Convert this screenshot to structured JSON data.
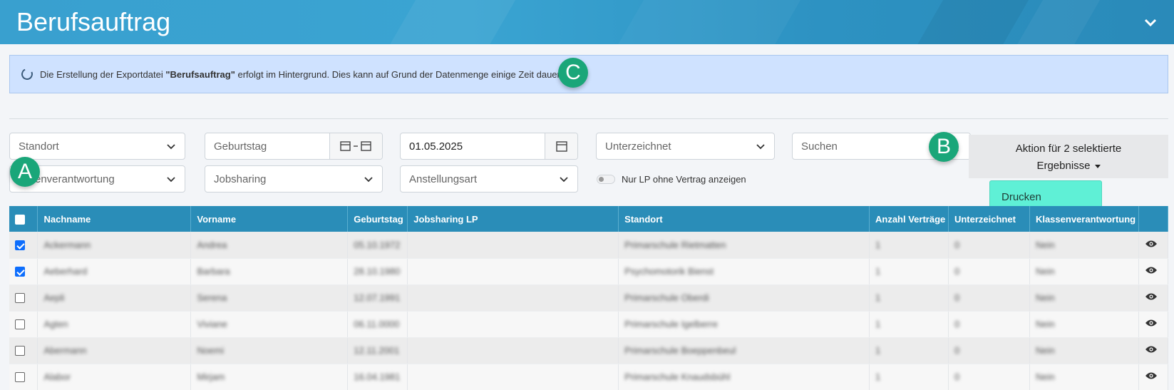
{
  "header": {
    "title": "Berufsauftrag"
  },
  "info": {
    "text_before": "Die Erstellung der Exportdatei ",
    "bold": "\"Berufsauftrag\"",
    "text_after": " erfolgt im Hintergrund. Dies kann auf Grund der Datenmenge einige Zeit dauern."
  },
  "filters": {
    "standort": "Standort",
    "geburtstag": "Geburtstag",
    "date": "01.05.2025",
    "unterzeichnet": "Unterzeichnet",
    "search_placeholder": "Suchen",
    "klassenverantwortung": "ssenverantwortung",
    "jobsharing": "Jobsharing",
    "anstellungsart": "Anstellungsart",
    "toggle_label": "Nur LP ohne Vertrag anzeigen"
  },
  "action": {
    "line1": "Aktion für 2 selektierte",
    "line2": "Ergebnisse",
    "menu_item": "Drucken"
  },
  "badges": {
    "a": "A",
    "b": "B",
    "c": "C"
  },
  "table": {
    "headers": [
      "Nachname",
      "Vorname",
      "Geburtstag",
      "Jobsharing LP",
      "Standort",
      "Anzahl Verträge",
      "Unterzeichnet",
      "Klassenverantwortung"
    ],
    "rows": [
      {
        "checked": true,
        "cells": [
          "Ackermann",
          "Andrea",
          "05.10.1972",
          "",
          "Primarschule Rietmatten",
          "1",
          "0",
          "Nein"
        ]
      },
      {
        "checked": true,
        "cells": [
          "Aeberhard",
          "Barbara",
          "28.10.1980",
          "",
          "Psychomotorik Bienst",
          "1",
          "0",
          "Nein"
        ]
      },
      {
        "checked": false,
        "cells": [
          "Aepli",
          "Serena",
          "12.07.1991",
          "",
          "Primarschule Oberdi",
          "1",
          "0",
          "Nein"
        ]
      },
      {
        "checked": false,
        "cells": [
          "Agten",
          "Viviane",
          "06.11.0000",
          "",
          "Primarschule Igelberre",
          "1",
          "0",
          "Nein"
        ]
      },
      {
        "checked": false,
        "cells": [
          "Abermann",
          "Noemi",
          "12.11.2001",
          "",
          "Primarschule Boeppenbeul",
          "1",
          "0",
          "Nein"
        ]
      },
      {
        "checked": false,
        "cells": [
          "Alabor",
          "Mirjam",
          "16.04.1981",
          "",
          "Primarschule Knaudsbühl",
          "1",
          "0",
          "Nein"
        ]
      }
    ]
  },
  "colors": {
    "header": "#39a0cf",
    "table_header": "#2a8db8",
    "badge": "#1aa679",
    "dropdown": "#5ff0d6",
    "info_bg": "#cfe2ff"
  }
}
